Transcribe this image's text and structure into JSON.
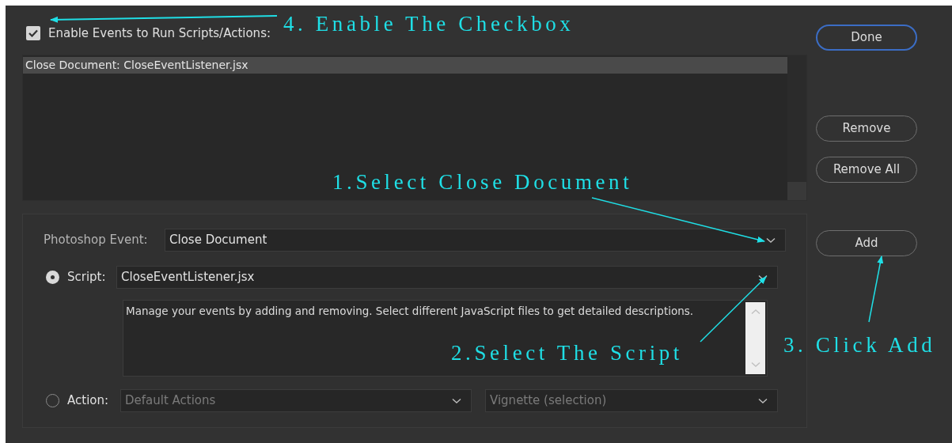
{
  "enable_events": {
    "label": "Enable Events to Run Scripts/Actions:",
    "checked": true
  },
  "event_list": {
    "items": [
      {
        "text": "Close Document: CloseEventListener.jsx",
        "selected": true
      }
    ]
  },
  "photoshop_event": {
    "label": "Photoshop Event:",
    "value": "Close Document"
  },
  "script": {
    "label": "Script:",
    "selected": true,
    "value": "CloseEventListener.jsx",
    "description": "Manage your events by adding and removing. Select different JavaScript files to get detailed descriptions."
  },
  "action": {
    "label": "Action:",
    "selected": false,
    "disabled": true,
    "set": "Default Actions",
    "action": "Vignette (selection)"
  },
  "done_button": {
    "label": "Done",
    "focused": true
  },
  "list_buttons": [
    {
      "label": "Remove"
    },
    {
      "label": "Remove All"
    }
  ],
  "add_button": {
    "label": "Add"
  },
  "annotations": [
    {
      "text": "4. Enable The Checkbox"
    },
    {
      "text": "1.Select Close Document"
    },
    {
      "text": "2.Select The Script"
    },
    {
      "text": "3. Click Add"
    }
  ]
}
